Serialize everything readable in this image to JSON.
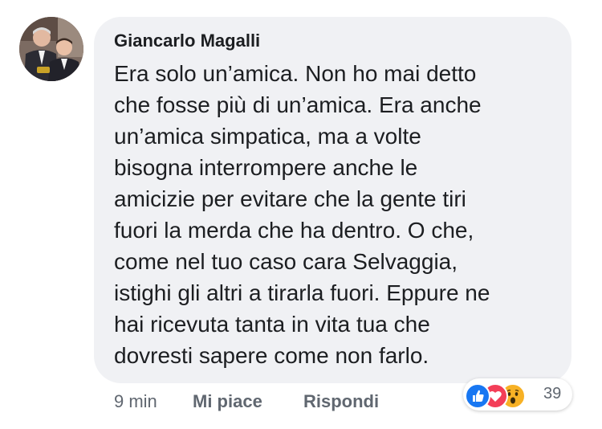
{
  "comment": {
    "author": "Giancarlo Magalli",
    "lines": [
      "Era solo un’amica. Non ho mai detto",
      "che fosse più di un’amica. Era anche",
      "un’amica simpatica, ma a volte",
      "bisogna interrompere anche le",
      "amicizie per evitare che la gente tiri",
      "fuori la merda che ha dentro. O che,",
      "come nel tuo caso cara Selvaggia,",
      "istighi gli altri a tirarla fuori. Eppure ne",
      "hai ricevuta tanta in vita tua che",
      "dovresti sapere come non farlo."
    ]
  },
  "meta": {
    "time": "9 min",
    "like_label": "Mi piace",
    "reply_label": "Rispondi"
  },
  "reactions": {
    "types": [
      "like-icon",
      "love-icon",
      "wow-icon"
    ],
    "count": "39"
  },
  "colors": {
    "bubble": "#f0f1f4",
    "text": "#1c1e21",
    "secondary": "#606770",
    "like": "#1877f2",
    "love": "#f33e58",
    "wow": "#f7b125"
  }
}
